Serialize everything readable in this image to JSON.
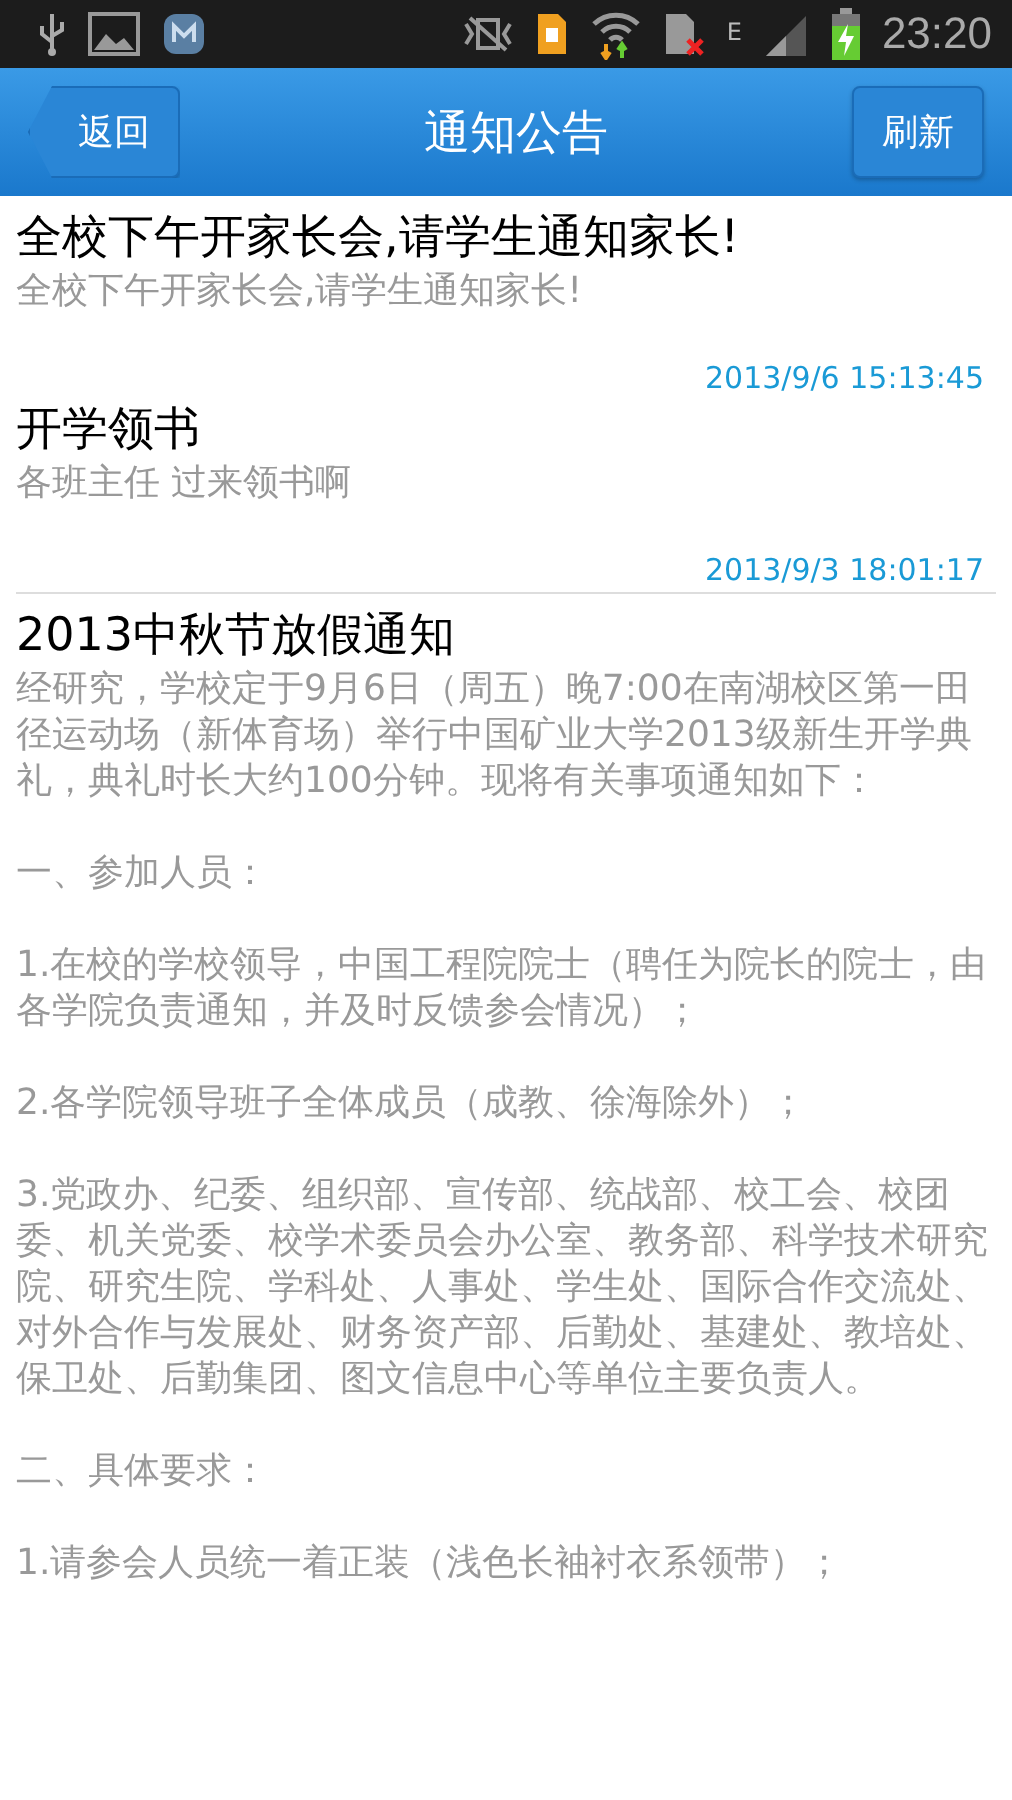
{
  "status_bar": {
    "network_type": "E",
    "time": "23:20"
  },
  "header": {
    "back_button": "返回",
    "title": "通知公告",
    "refresh_button": "刷新"
  },
  "notices": [
    {
      "title": "全校下午开家长会,请学生通知家长!",
      "summary": [
        "全校下午开家长会,请学生通知家长!"
      ],
      "date": "2013/9/6 15:13:45"
    },
    {
      "title": "开学领书",
      "summary": [
        "各班主任 过来领书啊"
      ],
      "date": "2013/9/3 18:01:17"
    },
    {
      "title": "2013中秋节放假通知",
      "summary": [
        "经研究，学校定于9月6日（周五）晚7:00在南湖校区第一田径运动场（新体育场）举行中国矿业大学2013级新生开学典礼，典礼时长大约100分钟。现将有关事项通知如下：",
        "一、参加人员：",
        "1.在校的学校领导，中国工程院院士（聘任为院长的院士，由各学院负责通知，并及时反馈参会情况）；",
        "2.各学院领导班子全体成员（成教、徐海除外）；",
        "3.党政办、纪委、组织部、宣传部、统战部、校工会、校团委、机关党委、校学术委员会办公室、教务部、科学技术研究院、研究生院、学科处、人事处、学生处、国际合作交流处、对外合作与发展处、财务资产部、后勤处、基建处、教培处、保卫处、后勤集团、图文信息中心等单位主要负责人。",
        "二、具体要求：",
        "1.请参会人员统一着正装（浅色长袖衬衣系领带）；"
      ]
    }
  ]
}
